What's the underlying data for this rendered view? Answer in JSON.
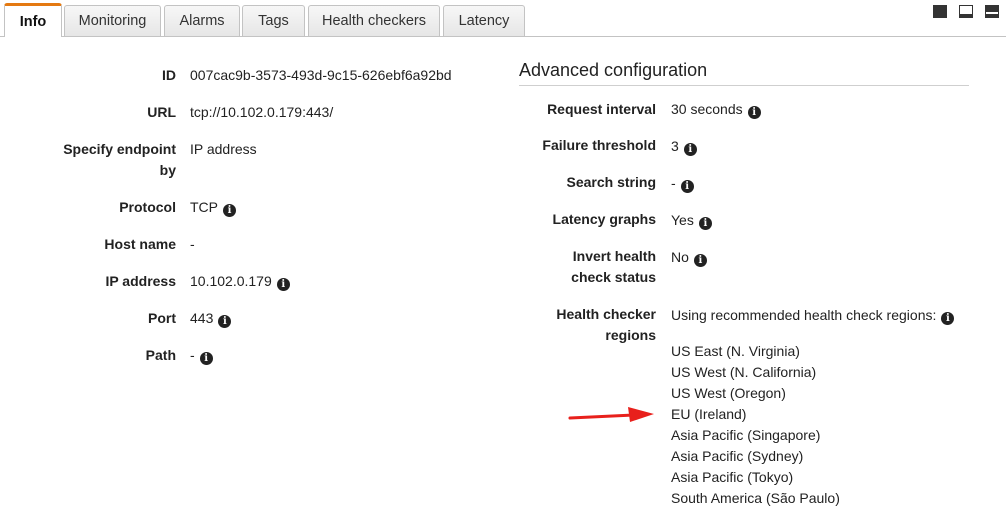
{
  "tabs": [
    {
      "label": "Info",
      "active": true
    },
    {
      "label": "Monitoring"
    },
    {
      "label": "Alarms"
    },
    {
      "label": "Tags"
    },
    {
      "label": "Health checkers"
    },
    {
      "label": "Latency"
    }
  ],
  "window_controls": [
    "minimize-icon",
    "restore-icon",
    "maximize-icon"
  ],
  "info": {
    "id": {
      "label": "ID",
      "value": "007cac9b-3573-493d-9c15-626ebf6a92bd"
    },
    "url": {
      "label": "URL",
      "value": "tcp://10.102.0.179:443/"
    },
    "endpoint": {
      "label_line1": "Specify endpoint",
      "label_line2": "by",
      "value": "IP address"
    },
    "protocol": {
      "label": "Protocol",
      "value": "TCP"
    },
    "host_name": {
      "label": "Host name",
      "value": "-"
    },
    "ip_address": {
      "label": "IP address",
      "value": "10.102.0.179"
    },
    "port": {
      "label": "Port",
      "value": "443"
    },
    "path": {
      "label": "Path",
      "value": "-"
    }
  },
  "advanced": {
    "title": "Advanced configuration",
    "request_interval": {
      "label": "Request interval",
      "value": "30 seconds"
    },
    "failure_threshold": {
      "label": "Failure threshold",
      "value": "3"
    },
    "search_string": {
      "label": "Search string",
      "value": "-"
    },
    "latency_graphs": {
      "label": "Latency graphs",
      "value": "Yes"
    },
    "invert": {
      "label_line1": "Invert health",
      "label_line2": "check status",
      "value": "No"
    },
    "regions": {
      "label_line1": "Health checker",
      "label_line2": "regions",
      "value": "Using recommended health check regions:",
      "items": [
        "US East (N. Virginia)",
        "US West (N. California)",
        "US West (Oregon)",
        "EU (Ireland)",
        "Asia Pacific (Singapore)",
        "Asia Pacific (Sydney)",
        "Asia Pacific (Tokyo)",
        "South America (São Paulo)"
      ]
    }
  },
  "colors": {
    "active_tab_accent": "#e47911",
    "annotation_arrow": "#e8201c"
  }
}
